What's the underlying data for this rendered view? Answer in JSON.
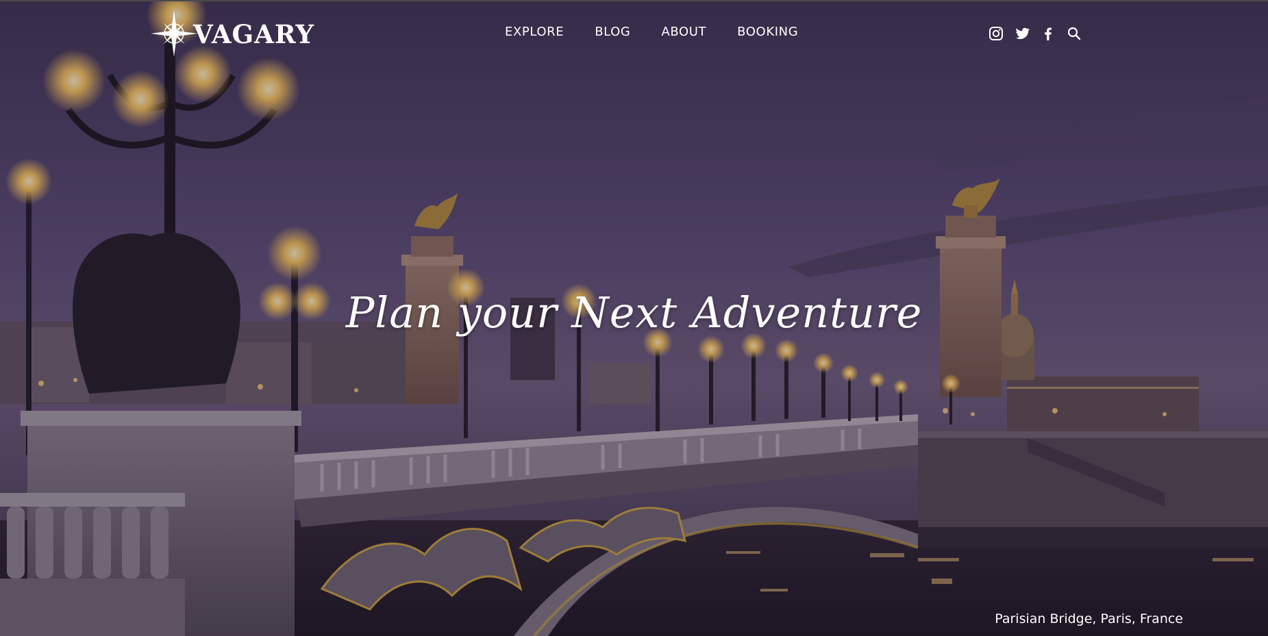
{
  "brand": {
    "name": "VAGARY",
    "logo_icon": "compass-star-icon"
  },
  "nav": {
    "items": [
      {
        "label": "EXPLORE"
      },
      {
        "label": "BLOG"
      },
      {
        "label": "ABOUT"
      },
      {
        "label": "BOOKING"
      }
    ]
  },
  "socials": {
    "icons": [
      "instagram-icon",
      "twitter-icon",
      "facebook-icon",
      "search-icon"
    ]
  },
  "hero": {
    "tagline": "Plan your Next Adventure",
    "caption": "Parisian Bridge, Paris, France"
  },
  "colors": {
    "text": "#ffffff",
    "sky_overlay": "#4b3f63",
    "lamp_glow": "#ffcf73",
    "gold": "#c9a13b"
  }
}
